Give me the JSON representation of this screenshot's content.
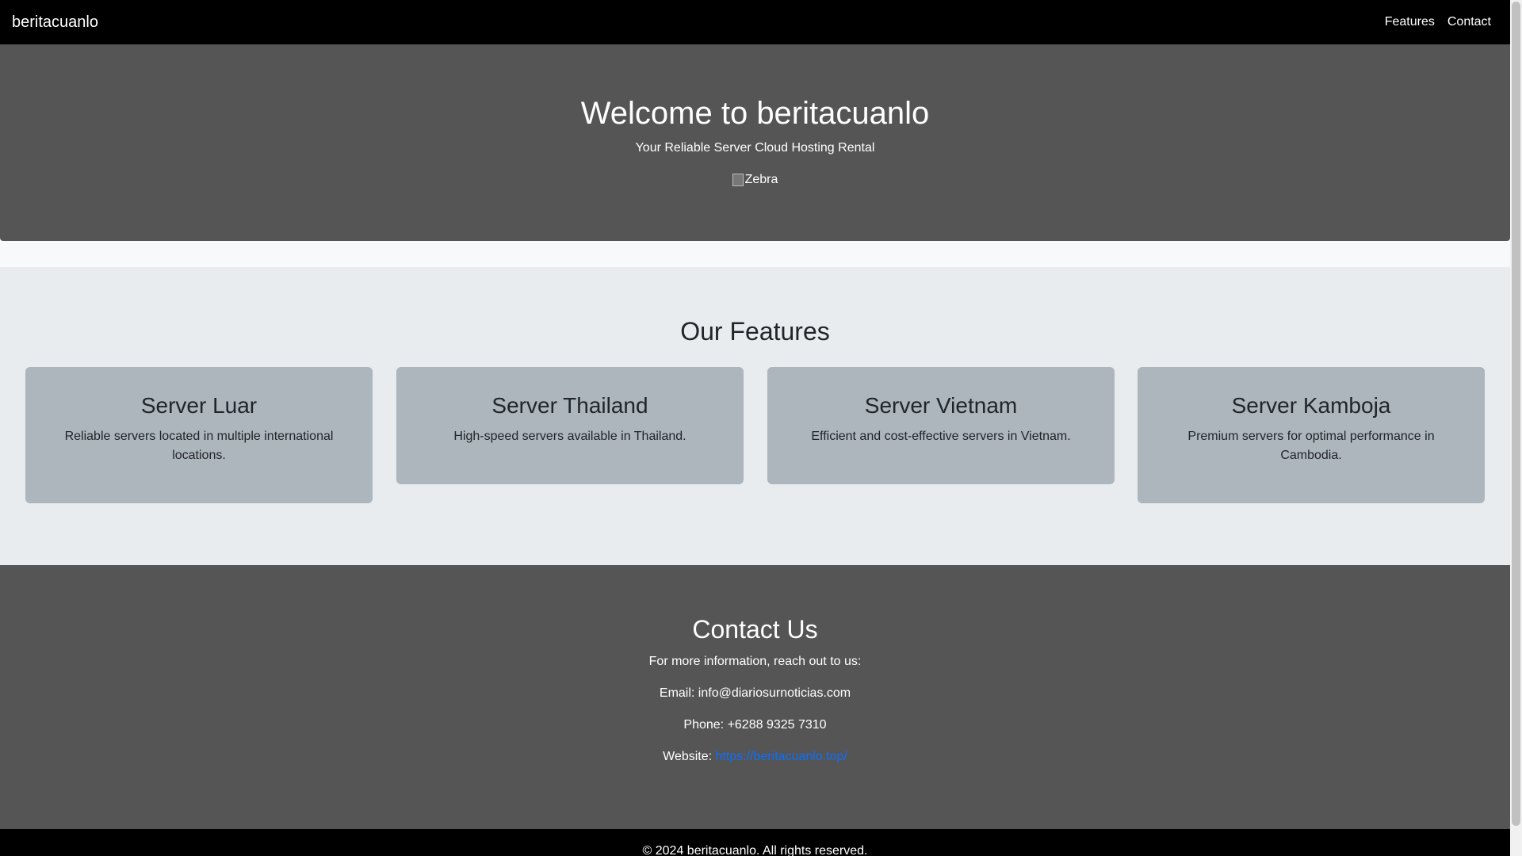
{
  "navbar": {
    "brand": "beritacuanlo",
    "links": [
      {
        "label": "Features"
      },
      {
        "label": "Contact"
      }
    ]
  },
  "hero": {
    "title": "Welcome to beritacuanlo",
    "tagline": "Your Reliable Server Cloud Hosting Rental",
    "image_alt": "Zebra"
  },
  "features": {
    "heading": "Our Features",
    "cards": [
      {
        "title": "Server Luar",
        "description": "Reliable servers located in multiple international locations."
      },
      {
        "title": "Server Thailand",
        "description": "High-speed servers available in Thailand."
      },
      {
        "title": "Server Vietnam",
        "description": "Efficient and cost-effective servers in Vietnam."
      },
      {
        "title": "Server Kamboja",
        "description": "Premium servers for optimal performance in Cambodia."
      }
    ]
  },
  "contact": {
    "heading": "Contact Us",
    "intro": "For more information, reach out to us:",
    "email": "Email: info@diariosurnoticias.com",
    "phone": "Phone: +6288 9325 7310",
    "website_label": "Website: ",
    "website_url": "https://beritacuanlo.top/"
  },
  "footer": {
    "copyright": "© 2024 beritacuanlo. All rights reserved."
  },
  "colors": {
    "navbar_bg": "#000000",
    "hero_bg": "#555555",
    "features_bg": "#e9ecef",
    "card_bg": "#adb5bd",
    "link": "#0d6efd"
  }
}
